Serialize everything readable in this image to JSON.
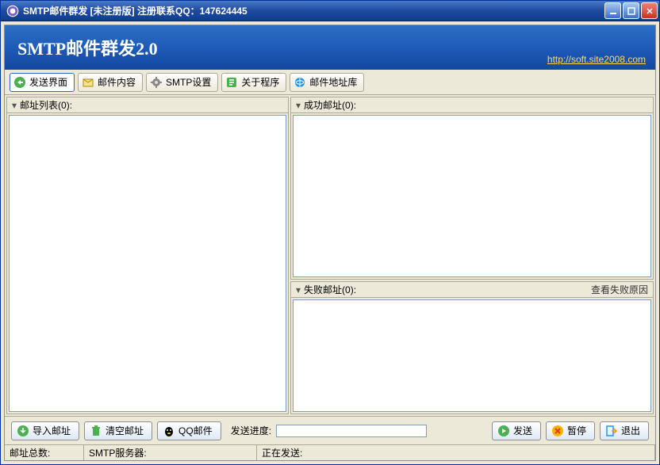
{
  "window": {
    "title": "SMTP邮件群发 [未注册版] 注册联系QQ：147624445"
  },
  "header": {
    "title": "SMTP邮件群发2.0",
    "link": "http://soft.site2008.com"
  },
  "toolbar": {
    "tabs": [
      {
        "label": "发送界面",
        "icon": "send-interface-icon"
      },
      {
        "label": "邮件内容",
        "icon": "mail-content-icon"
      },
      {
        "label": "SMTP设置",
        "icon": "smtp-settings-icon"
      },
      {
        "label": "关于程序",
        "icon": "about-icon"
      },
      {
        "label": "邮件地址库",
        "icon": "address-db-icon"
      }
    ]
  },
  "panels": {
    "addrlist_label": "邮址列表(0):",
    "success_label": "成功邮址(0):",
    "fail_label": "失败邮址(0):",
    "fail_link": "查看失败原因"
  },
  "bottom": {
    "import": "导入邮址",
    "clear": "清空邮址",
    "qq": "QQ邮件",
    "progress_label": "发送进度:",
    "send": "发送",
    "pause": "暂停",
    "exit": "退出"
  },
  "status": {
    "total": "邮址总数:",
    "smtp": "SMTP服务器:",
    "sending": "正在发送:"
  }
}
